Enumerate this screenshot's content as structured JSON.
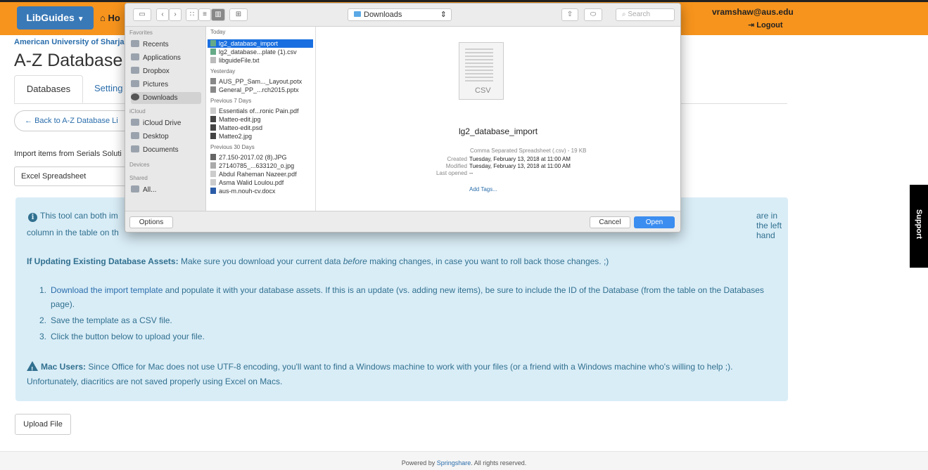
{
  "topbar": {
    "brand": "LibGuides",
    "home": "Ho",
    "user_email": "vramshaw@aus.edu",
    "logout": "Logout"
  },
  "page": {
    "site_name": "American University of Sharjah",
    "title": "A-Z Database L",
    "tabs": [
      "Databases",
      "Setting"
    ],
    "back_button": "Back to A-Z Database Li",
    "import_label": "Import items from Serials Soluti",
    "format_select": "Excel Spreadsheet",
    "upload_button": "Upload File",
    "support": "Support"
  },
  "info": {
    "line1_start": "This tool can both im",
    "line1_end": "are in the left hand",
    "line2": "column in the table on th",
    "update_label": "If Updating Existing Database Assets:",
    "update_text_a": " Make sure you download your current data ",
    "update_text_em": "before",
    "update_text_b": " making changes, in case you want to roll back those changes. ;)",
    "steps": [
      {
        "num": "1.",
        "link": "Download the import template",
        "text": " and populate it with your database assets. If this is an update (vs. adding new items), be sure to include the ID of the Database (from the table on the Databases page)."
      },
      {
        "num": "2.",
        "link": "",
        "text": "Save the template as a CSV file."
      },
      {
        "num": "3.",
        "link": "",
        "text": "Click the button below to upload your file."
      }
    ],
    "mac_label": "Mac Users:",
    "mac_text": " Since Office for Mac does not use UTF-8 encoding, you'll want to find a Windows machine to work with your files (or a friend with a Windows machine who's willing to help ;). Unfortunately, diacritics are not saved properly using Excel on Macs."
  },
  "footer": {
    "prefix": "Powered by ",
    "link": "Springshare",
    "suffix": ".  All rights reserved."
  },
  "dialog": {
    "folder": "Downloads",
    "search_placeholder": "Search",
    "sidebar": {
      "favorites_head": "Favorites",
      "favorites": [
        "Recents",
        "Applications",
        "Dropbox",
        "Pictures",
        "Downloads"
      ],
      "icloud_head": "iCloud",
      "icloud": [
        "iCloud Drive",
        "Desktop",
        "Documents"
      ],
      "devices_head": "Devices",
      "shared_head": "Shared",
      "shared": [
        "All..."
      ]
    },
    "groups": [
      {
        "head": "Today",
        "files": [
          "lg2_database_import",
          "lg2_database...plate (1).csv",
          "libguideFile.txt"
        ]
      },
      {
        "head": "Yesterday",
        "files": [
          "AUS_PP_Sam..._Layout.potx",
          "General_PP_...rch2015.pptx"
        ]
      },
      {
        "head": "Previous 7 Days",
        "files": [
          "Essentials of...ronic Pain.pdf",
          "Matteo-edit.jpg",
          "Matteo-edit.psd",
          "Matteo2.jpg"
        ]
      },
      {
        "head": "Previous 30 Days",
        "files": [
          "27.150-2017.02 (8).JPG",
          "27140785_...633120_o.jpg",
          "Abdul Raheman Nazeer.pdf",
          "Asma Walid Loulou.pdf",
          "aus-m.nouh-cv.docx"
        ]
      }
    ],
    "preview": {
      "icon_label": "CSV",
      "name": "lg2_database_import",
      "kind": "Comma Separated Spreadsheet (.csv) - 19 KB",
      "created_label": "Created",
      "created": "Tuesday, February 13, 2018 at 11:00 AM",
      "modified_label": "Modified",
      "modified": "Tuesday, February 13, 2018 at 11:00 AM",
      "last_opened_label": "Last opened",
      "last_opened": "--",
      "add_tags": "Add Tags..."
    },
    "options_button": "Options",
    "cancel_button": "Cancel",
    "open_button": "Open"
  }
}
